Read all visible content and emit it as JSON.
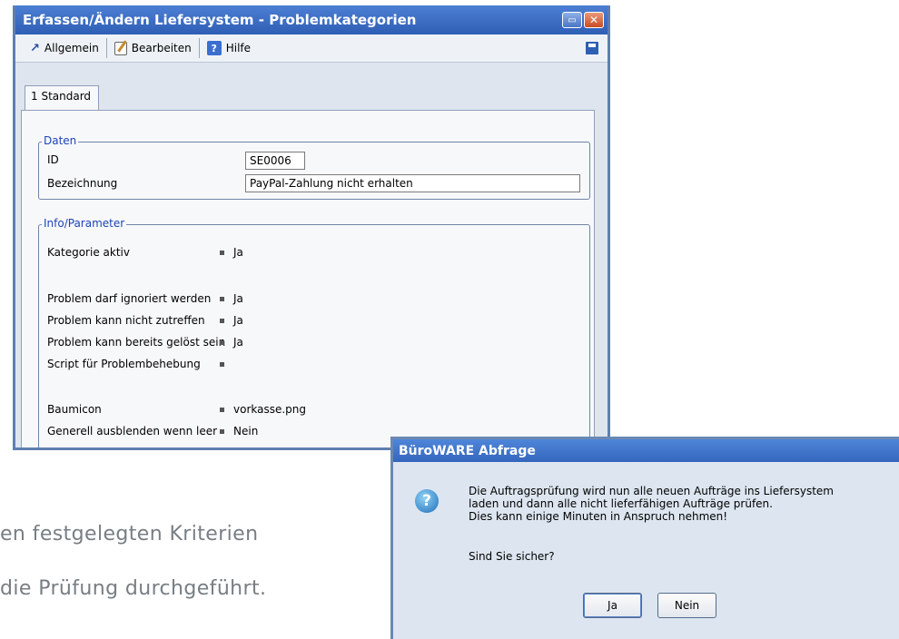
{
  "background": {
    "line1": "en festgelegten Kriterien",
    "line2": "die Prüfung durchgeführt."
  },
  "main_window": {
    "title": "Erfassen/Ändern Liefersystem - Problemkategorien",
    "menu": [
      {
        "icon": "arrow-icon",
        "label": "Allgemein"
      },
      {
        "icon": "edit-icon",
        "label": "Bearbeiten"
      },
      {
        "icon": "help-icon",
        "label": "Hilfe"
      }
    ],
    "tab": "1 Standard",
    "daten": {
      "legend": "Daten",
      "id_label": "ID",
      "id_value": "SE0006",
      "bez_label": "Bezeichnung",
      "bez_value": "PayPal-Zahlung nicht erhalten"
    },
    "info": {
      "legend": "Info/Parameter",
      "rows": [
        {
          "label": "Kategorie aktiv",
          "value": "Ja"
        },
        {
          "label": "Problem darf ignoriert werden",
          "value": "Ja"
        },
        {
          "label": "Problem kann nicht zutreffen",
          "value": "Ja"
        },
        {
          "label": "Problem kann bereits gelöst sein",
          "value": "Ja"
        },
        {
          "label": "Script für Problembehebung",
          "value": ""
        },
        {
          "label": "Baumicon",
          "value": "vorkasse.png"
        },
        {
          "label": "Generell ausblenden wenn leer",
          "value": "Nein"
        }
      ]
    }
  },
  "dialog": {
    "title": "BüroWARE Abfrage",
    "lines": [
      "Die Auftragsprüfung wird nun alle neuen Aufträge ins Liefersystem",
      "laden und dann alle nicht lieferfähigen Aufträge prüfen.",
      "Dies kann einige Minuten in Anspruch nehmen!"
    ],
    "question": "Sind Sie sicher?",
    "yes": "Ja",
    "no": "Nein"
  }
}
